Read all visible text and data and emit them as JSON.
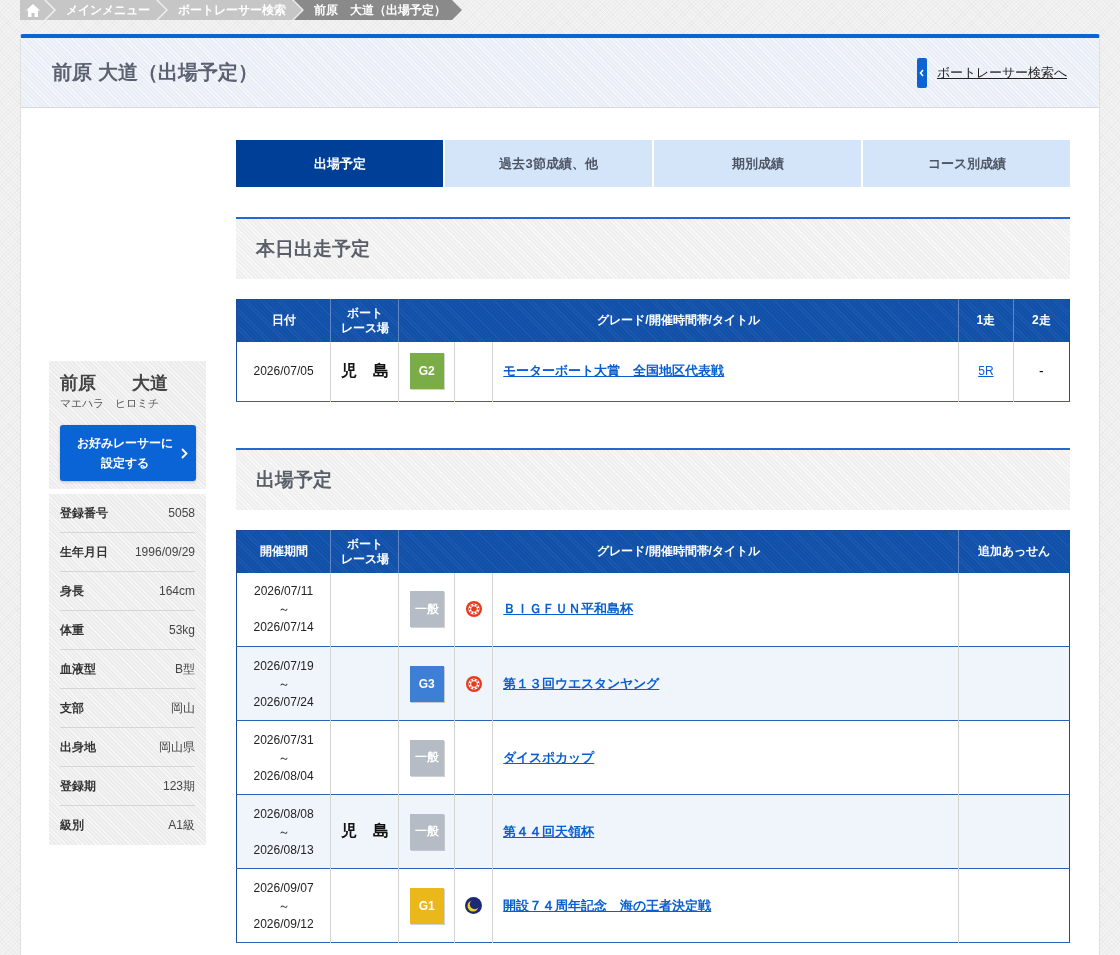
{
  "breadcrumb": [
    {
      "label": "メインメニュー",
      "current": false
    },
    {
      "label": "ボートレーサー検索",
      "current": false
    },
    {
      "label": "前原　大道（出場予定）",
      "current": true
    }
  ],
  "header": {
    "title": "前原 大道（出場予定）",
    "back_link": "ボートレーサー検索へ"
  },
  "tabs": [
    {
      "label": "出場予定",
      "selected": true
    },
    {
      "label": "過去3節成績、他",
      "selected": false
    },
    {
      "label": "期別成績",
      "selected": false
    },
    {
      "label": "コース別成績",
      "selected": false
    }
  ],
  "profile": {
    "name": "前原　　大道",
    "kana": "マエハラ　ヒロミチ",
    "favorite_button": "お好みレーサーに設定する",
    "details": [
      {
        "label": "登録番号",
        "value": "5058"
      },
      {
        "label": "生年月日",
        "value": "1996/09/29"
      },
      {
        "label": "身長",
        "value": "164cm"
      },
      {
        "label": "体重",
        "value": "53kg"
      },
      {
        "label": "血液型",
        "value": "B型"
      },
      {
        "label": "支部",
        "value": "岡山"
      },
      {
        "label": "出身地",
        "value": "岡山県"
      },
      {
        "label": "登録期",
        "value": "123期"
      },
      {
        "label": "級別",
        "value": "A1級"
      }
    ]
  },
  "today": {
    "heading": "本日出走予定",
    "columns": [
      "日付",
      "ボートレース場",
      "グレード/開催時間帯/タイトル",
      "1走",
      "2走"
    ],
    "rows": [
      {
        "date": "2026/07/05",
        "venue": "児　島",
        "grade": {
          "label": "G2",
          "color": "#7aad48"
        },
        "title": "モーターボート大賞　全国地区代表戦",
        "race_1": "5R",
        "race_2": "-"
      }
    ]
  },
  "schedule": {
    "heading": "出場予定",
    "columns": [
      "開催期間",
      "ボートレース場",
      "グレード/開催時間帯/タイトル",
      "追加あっせん"
    ],
    "rows": [
      {
        "period": "2026/07/11\n～\n2026/07/14",
        "grade": {
          "label": "一般",
          "color": "#b5bcc5"
        },
        "session": {
          "kind": "day"
        },
        "title": "ＢＩＧＦＵＮ平和島杯"
      },
      {
        "period": "2026/07/19\n～\n2026/07/24",
        "grade": {
          "label": "G3",
          "color": "#3d7fd4"
        },
        "session": {
          "kind": "day"
        },
        "title": "第１３回ウエスタンヤング"
      },
      {
        "period": "2026/07/31\n～\n2026/08/04",
        "grade": {
          "label": "一般",
          "color": "#b5bcc5"
        },
        "title": "ダイスポカップ"
      },
      {
        "period": "2026/08/08\n～\n2026/08/13",
        "venue": "児　島",
        "grade": {
          "label": "一般",
          "color": "#b5bcc5"
        },
        "title": "第４４回天領杯"
      },
      {
        "period": "2026/09/07\n～\n2026/09/12",
        "grade": {
          "label": "G1",
          "color": "#eab81a"
        },
        "session": {
          "kind": "night"
        },
        "title": "開設７４周年記念　海の王者決定戦"
      }
    ]
  }
}
